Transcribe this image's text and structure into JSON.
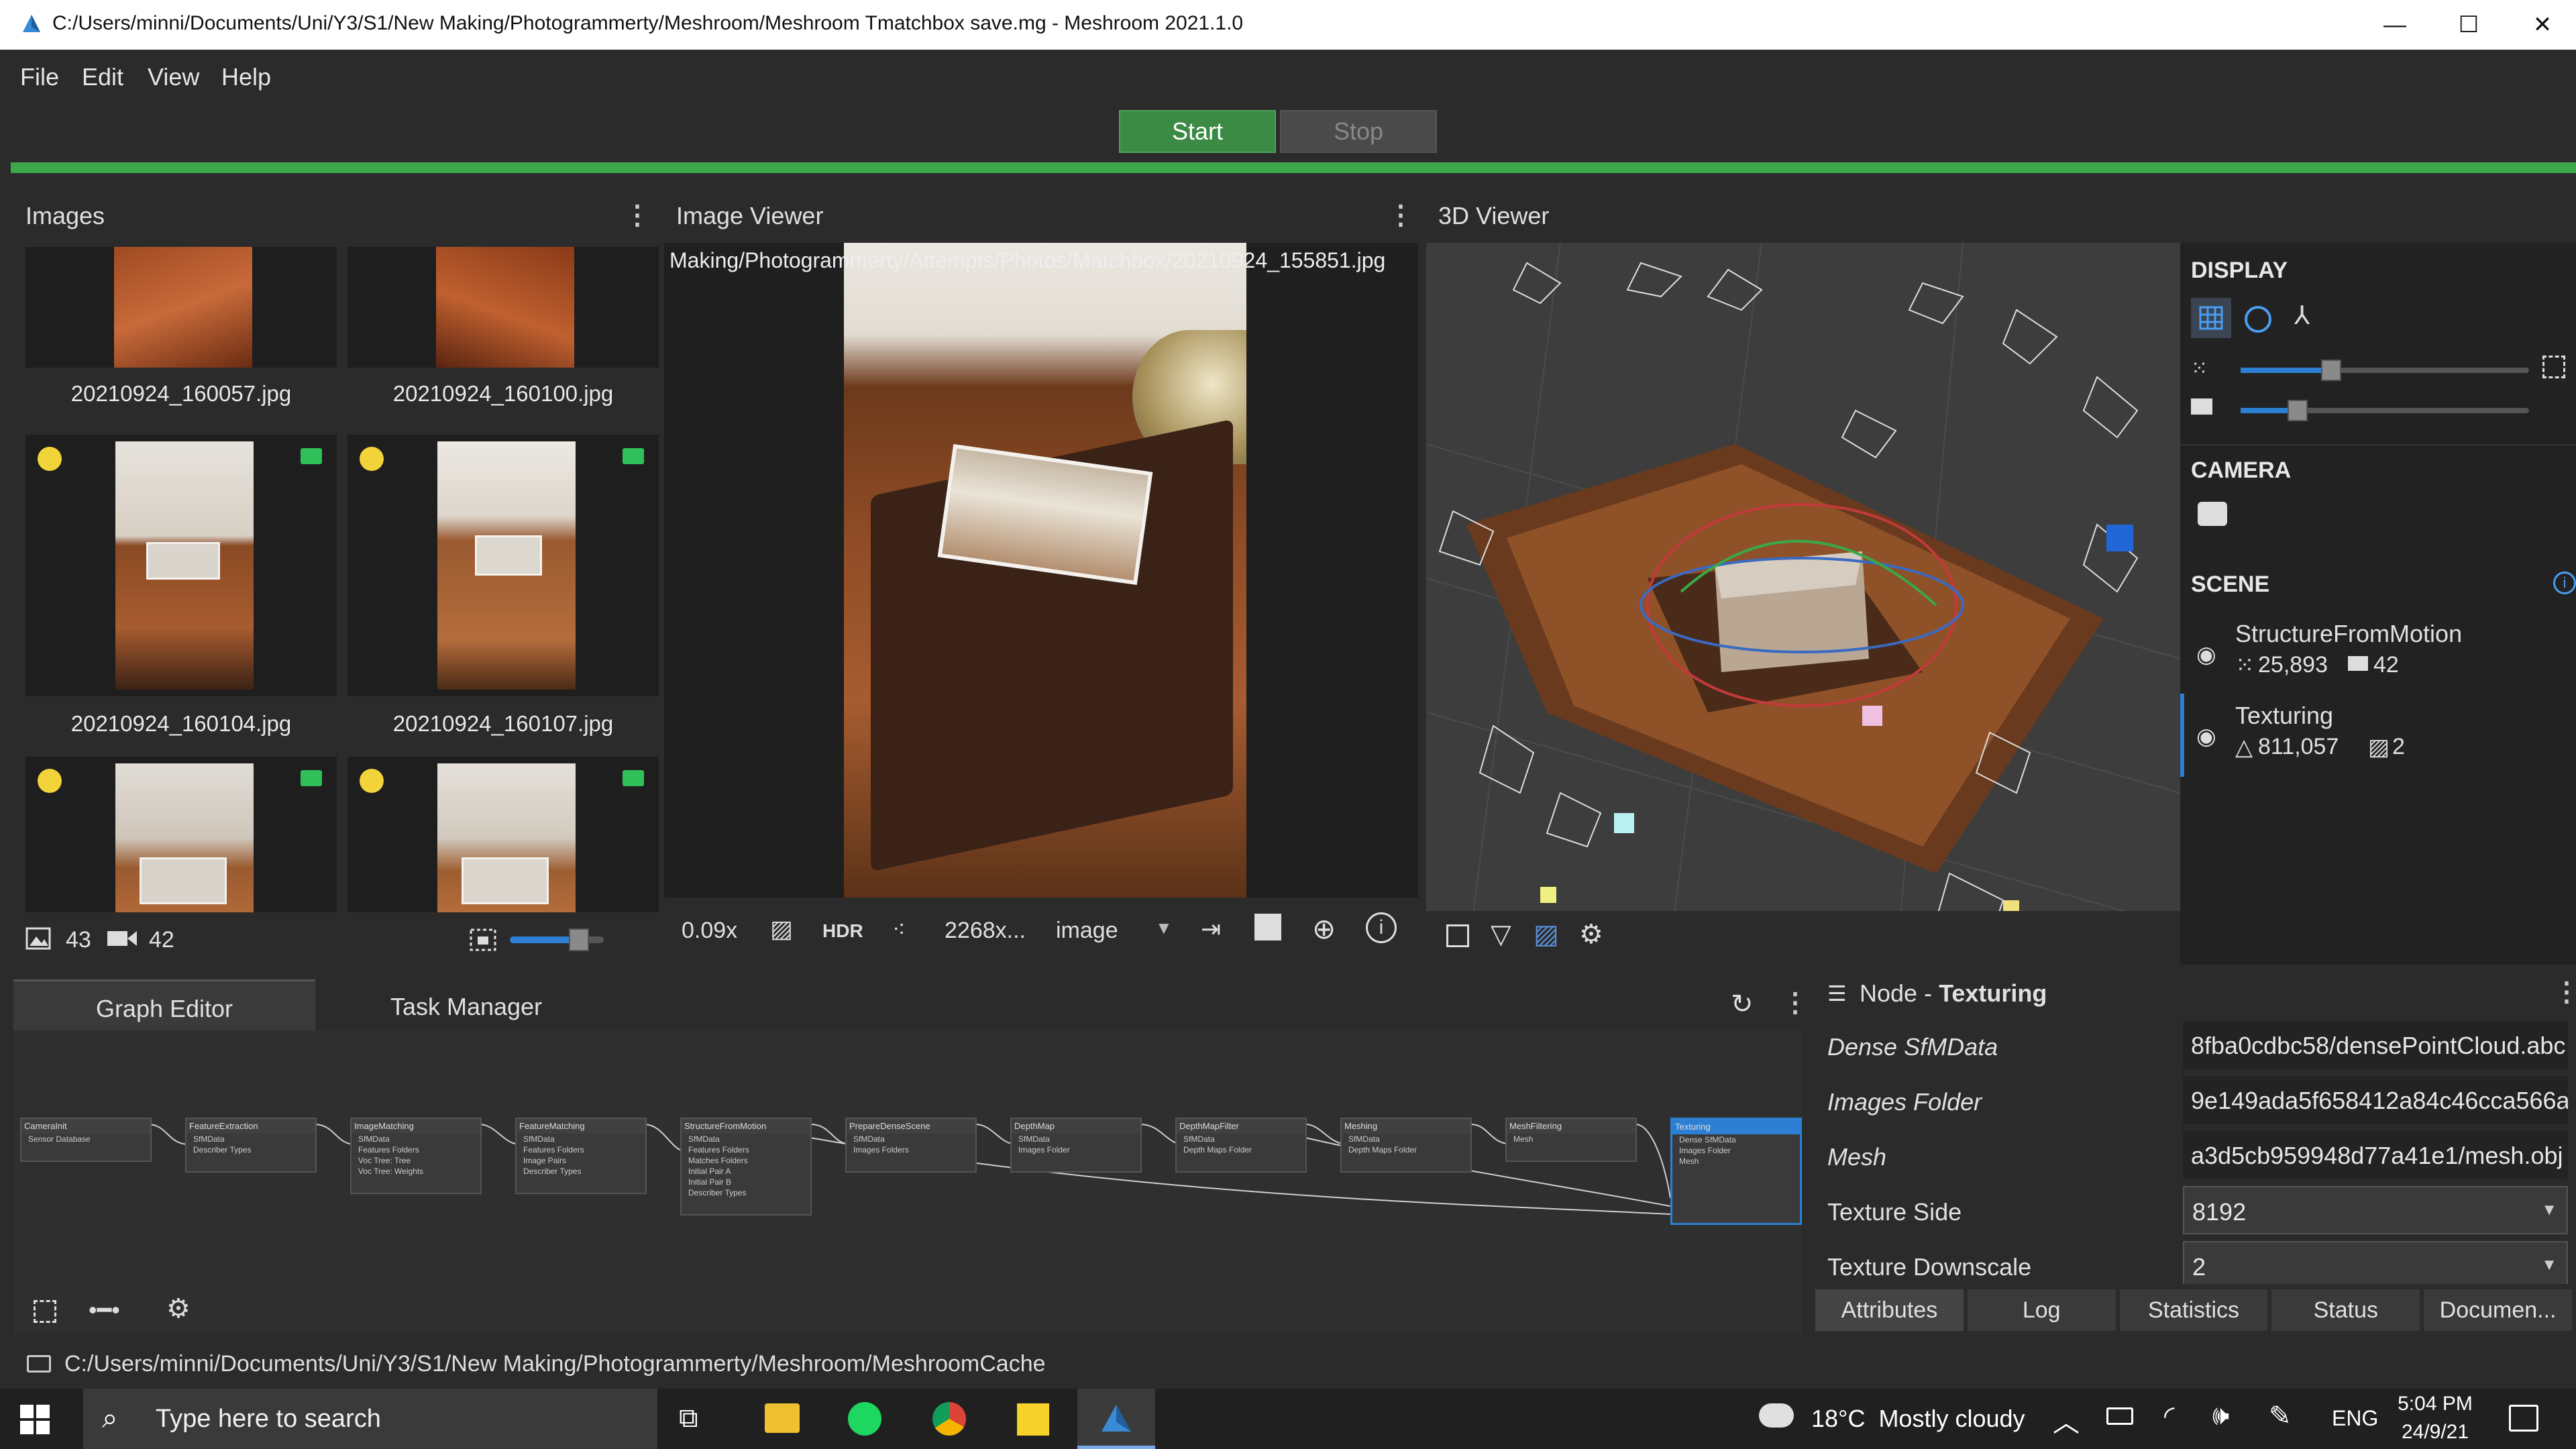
{
  "titlebar": {
    "title": "C:/Users/minni/Documents/Uni/Y3/S1/New Making/Photogrammerty/Meshroom/Meshroom Tmatchbox save.mg - Meshroom 2021.1.0",
    "minimize": "—",
    "maximize": "☐",
    "close": "✕"
  },
  "menu": [
    "File",
    "Edit",
    "View",
    "Help"
  ],
  "toolbar": {
    "start_label": "Start",
    "stop_label": "Stop"
  },
  "images_panel": {
    "title": "Images",
    "thumbnails": [
      {
        "name": "20210924_160057.jpg"
      },
      {
        "name": "20210924_160100.jpg"
      },
      {
        "name": "20210924_160104.jpg"
      },
      {
        "name": "20210924_160107.jpg"
      },
      {
        "name": ""
      },
      {
        "name": ""
      }
    ],
    "image_count": "43",
    "camera_count": "42"
  },
  "image_viewer": {
    "title": "Image Viewer",
    "path": "Making/Photogrammerty/Attempts/Photos/Matchbox/20210924_155851.jpg",
    "zoom": "0.09x",
    "hdr_label": "HDR",
    "resolution": "2268x...",
    "mode": "image"
  },
  "viewer3d": {
    "title": "3D Viewer",
    "display_title": "DISPLAY",
    "camera_title": "CAMERA",
    "scene_title": "SCENE",
    "scene_items": [
      {
        "name": "StructureFromMotion",
        "stat1": "25,893",
        "stat2": "42"
      },
      {
        "name": "Texturing",
        "stat1": "811,057",
        "stat2": "2"
      }
    ]
  },
  "tabs": {
    "graph_editor": "Graph Editor",
    "task_manager": "Task Manager"
  },
  "graph_nodes": [
    {
      "name": "CameraInit",
      "ports": [
        "Sensor Database"
      ]
    },
    {
      "name": "FeatureExtraction",
      "ports": [
        "SfMData",
        "Describer Types"
      ]
    },
    {
      "name": "ImageMatching",
      "ports": [
        "SfMData",
        "Features Folders",
        "Voc Tree: Tree",
        "Voc Tree: Weights"
      ]
    },
    {
      "name": "FeatureMatching",
      "ports": [
        "SfMData",
        "Features Folders",
        "Image Pairs",
        "Describer Types"
      ]
    },
    {
      "name": "StructureFromMotion",
      "ports": [
        "SfMData",
        "Features Folders",
        "Matches Folders",
        "Initial Pair A",
        "Initial Pair B",
        "Describer Types"
      ]
    },
    {
      "name": "PrepareDenseScene",
      "ports": [
        "SfMData",
        "Images Folders"
      ]
    },
    {
      "name": "DepthMap",
      "ports": [
        "SfMData",
        "Images Folder"
      ]
    },
    {
      "name": "DepthMapFilter",
      "ports": [
        "SfMData",
        "Depth Maps Folder"
      ]
    },
    {
      "name": "Meshing",
      "ports": [
        "SfMData",
        "Depth Maps Folder"
      ]
    },
    {
      "name": "MeshFiltering",
      "ports": [
        "Mesh"
      ]
    },
    {
      "name": "Texturing",
      "ports": [
        "Dense SfMData",
        "Images Folder",
        "Mesh"
      ]
    }
  ],
  "node_panel": {
    "prefix": "Node - ",
    "name": "Texturing",
    "attributes": [
      {
        "key": "Dense SfMData",
        "value": "8fba0cdbc58/densePointCloud.abc",
        "italic": true
      },
      {
        "key": "Images Folder",
        "value": "9e149ada5f658412a84c46cca566a",
        "italic": true
      },
      {
        "key": "Mesh",
        "value": "a3d5cb959948d77a41e1/mesh.obj",
        "italic": true
      },
      {
        "key": "Texture Side",
        "value": "8192",
        "italic": false
      },
      {
        "key": "Texture Downscale",
        "value": "2",
        "italic": false
      }
    ],
    "tabs": [
      "Attributes",
      "Log",
      "Statistics",
      "Status",
      "Documen..."
    ]
  },
  "statusbar": {
    "path": "C:/Users/minni/Documents/Uni/Y3/S1/New Making/Photogrammerty/Meshroom/MeshroomCache"
  },
  "taskbar": {
    "search_placeholder": "Type here to search",
    "weather": "18°C  Mostly cloudy",
    "lang": "ENG",
    "time": "5:04 PM",
    "date": "24/9/21"
  },
  "colors": {
    "accent_green": "#3da84a",
    "start_button": "#3b8a45",
    "selection_blue": "#2d7fd3"
  }
}
